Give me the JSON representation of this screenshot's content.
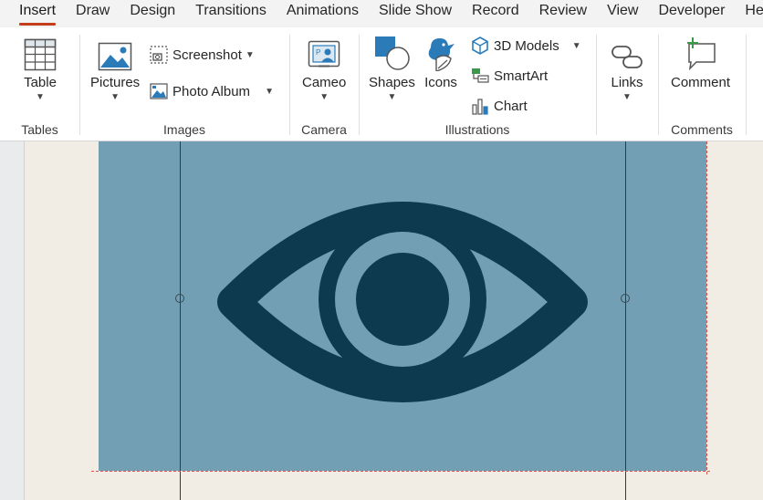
{
  "tabs": [
    "Insert",
    "Draw",
    "Design",
    "Transitions",
    "Animations",
    "Slide Show",
    "Record",
    "Review",
    "View",
    "Developer",
    "Hel"
  ],
  "active_tab": "Insert",
  "ribbon": {
    "tables": {
      "label": "Tables",
      "table_btn": "Table"
    },
    "images": {
      "label": "Images",
      "pictures_btn": "Pictures",
      "screenshot_btn": "Screenshot",
      "photo_album_btn": "Photo Album"
    },
    "camera": {
      "label": "Camera",
      "cameo_btn": "Cameo"
    },
    "illustrations": {
      "label": "Illustrations",
      "shapes_btn": "Shapes",
      "icons_btn": "Icons",
      "models_btn": "3D Models",
      "smartart_btn": "SmartArt",
      "chart_btn": "Chart"
    },
    "links": {
      "links_btn": "Links"
    },
    "comments": {
      "label": "Comments",
      "comment_btn": "Comment"
    }
  },
  "colors": {
    "accent_underline": "#c43e1c",
    "icon_blue": "#2b7bb9",
    "shape_fill": "#729fb4",
    "eye_color": "#0d3a4e",
    "selection_dash": "#d9534f"
  },
  "icons": [
    "table-icon",
    "pictures-icon",
    "screenshot-icon",
    "photo-album-icon",
    "cameo-icon",
    "shapes-icon",
    "icons-icon",
    "3d-models-icon",
    "smartart-icon",
    "chart-icon",
    "links-icon",
    "comment-icon",
    "eye-icon"
  ]
}
